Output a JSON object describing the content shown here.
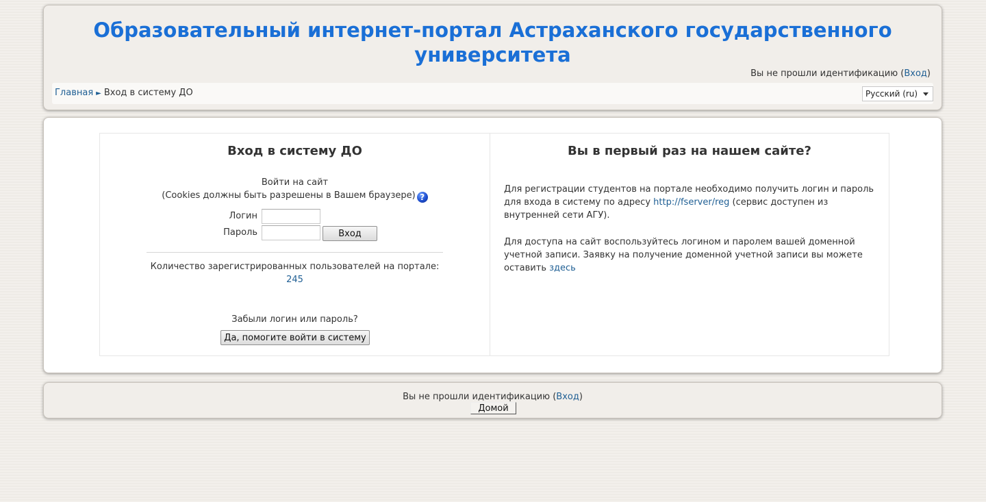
{
  "header": {
    "title": "Образовательный интернет-портал Астраханского государственного университета",
    "login_status_prefix": "Вы не прошли идентификацию (",
    "login_link": "Вход",
    "login_status_suffix": ")"
  },
  "navbar": {
    "breadcrumb_home": "Главная",
    "breadcrumb_separator": "►",
    "breadcrumb_current": "Вход в систему ДО",
    "language_selected": "Русский (ru)"
  },
  "login_panel": {
    "title": "Вход в систему ДО",
    "subtitle_line1": "Войти на сайт",
    "subtitle_line2": "(Cookies должны быть разрешены в Вашем браузере)",
    "help_icon_glyph": "?",
    "username_label": "Логин",
    "username_value": "",
    "password_label": "Пароль",
    "password_value": "",
    "login_button": "Вход",
    "users_count_label": "Количество зарегистрированных пользователей на портале:",
    "users_count_value": "245",
    "forgot_label": "Забыли логин или пароль?",
    "forgot_button": "Да, помогите войти в систему"
  },
  "signup_panel": {
    "title": "Вы в первый раз на нашем сайте?",
    "para1_before_link": "Для регистрации студентов на портале необходимо получить логин и пароль для входа в систему по адресу ",
    "para1_link": "http://fserver/reg",
    "para1_after_link": " (сервис доступен из внутренней сети АГУ).",
    "para2_before_link": "Для доступа на сайт воспользуйтесь логином и паролем вашей доменной учетной записи. Заявку на получение доменной учетной записи вы можете оставить ",
    "para2_link": "здесь"
  },
  "footer": {
    "login_status_prefix": "Вы не прошли идентификацию (",
    "login_link": "Вход",
    "login_status_suffix": ")",
    "home_button": "Домой"
  },
  "colors": {
    "title_blue": "#1a6fd6",
    "link_blue": "#1f5f94",
    "page_background": "#f1eeea"
  }
}
